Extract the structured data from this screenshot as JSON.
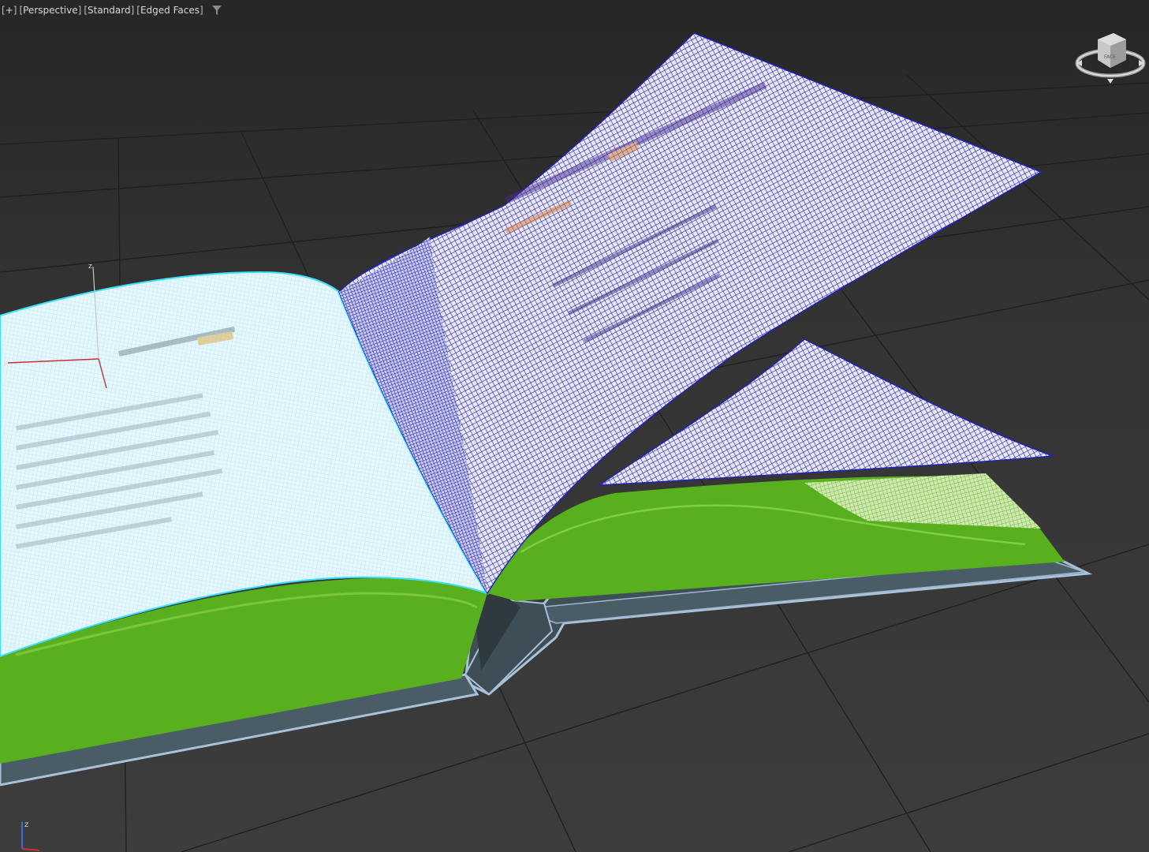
{
  "viewport": {
    "menu": {
      "plus": "+",
      "view": "Perspective",
      "shading": "Standard",
      "display": "Edged Faces"
    },
    "viewcube_face_label": "FACE",
    "gizmo_axes": {
      "x": "x",
      "z": "z"
    },
    "tripod_axes": {
      "z": "z"
    }
  },
  "colors": {
    "background": "#333333",
    "grid": "#1f1f1f",
    "page_wire": "#1f1fb8",
    "left_page": "#dff4fb",
    "page_block": "#58b01e",
    "cover": "#a9c2da",
    "selection_highlight": "#39e0ff"
  },
  "icons": [
    "filter-icon",
    "viewcube-icon",
    "axis-gizmo-icon",
    "axis-tripod-icon"
  ]
}
